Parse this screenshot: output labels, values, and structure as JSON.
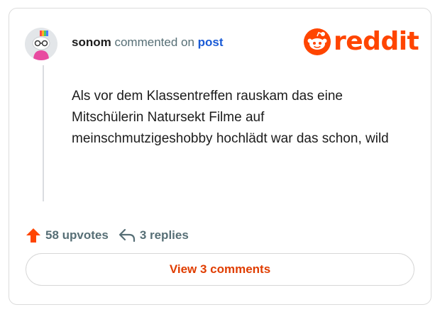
{
  "header": {
    "username": "sonom",
    "commented_text": "commented on",
    "post_link": "post",
    "avatar_icon": "snoo-avatar-icon"
  },
  "brand": {
    "wordmark": "reddit",
    "logo_icon": "reddit-snoo-icon",
    "color": "#ff4500"
  },
  "comment": {
    "text": "Als vor dem Klassentreffen rauskam das eine Mitschülerin Natursekt Filme auf meinschmutzigeshobby hochlädt war das schon, wild"
  },
  "stats": {
    "upvotes": "58 upvotes",
    "upvote_icon": "upvote-arrow-icon",
    "replies": "3 replies",
    "reply_icon": "reply-arrow-icon"
  },
  "actions": {
    "view_comments_label": "View 3 comments"
  }
}
